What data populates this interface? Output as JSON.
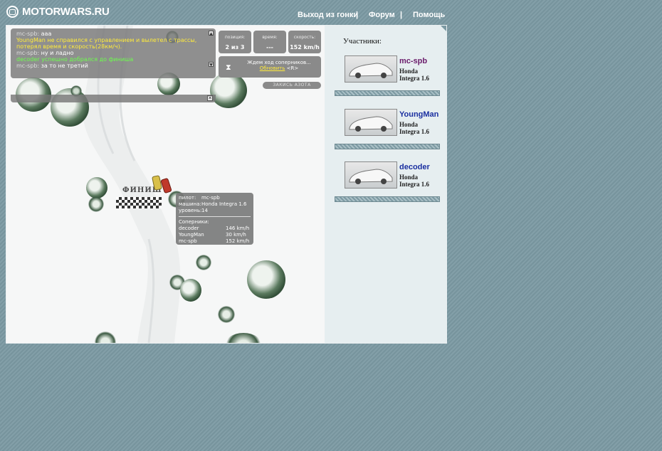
{
  "header": {
    "logo_text": "MOTORWARS.RU",
    "nav": [
      {
        "label": "Выход из гонки"
      },
      {
        "label": "Форум"
      },
      {
        "label": "Помощь"
      }
    ],
    "separator": "|"
  },
  "chat": {
    "lines": [
      {
        "nick": "mc-spb:",
        "text": "ааа",
        "color": "#ffffff"
      },
      {
        "nick": "",
        "text": "YoungMan не справился с управлением и вылетел с трассы,",
        "color": "#ffeb3b"
      },
      {
        "nick": "",
        "text": "потерял время и скорость(28км/ч).",
        "color": "#ffeb3b"
      },
      {
        "nick": "mc-spb:",
        "text": "ну и ладно",
        "color": "#ffffff"
      },
      {
        "nick": "",
        "text": "decoder успешно добрался до финиша",
        "color": "#6cff4c"
      },
      {
        "nick": "mc-spb:",
        "text": "за то не третий",
        "color": "#ffffff"
      }
    ],
    "scroll_up_icon": "▲",
    "scroll_down_icon": "▼",
    "close_icon": "✕"
  },
  "stats": {
    "position_label": "позиция:",
    "position_value": "2 из 3",
    "time_label": "время:",
    "time_value": "---",
    "speed_label": "скорость:",
    "speed_value": "152 km/h"
  },
  "wait": {
    "message": "Ждем ход соперников...",
    "refresh_label": "Обновить",
    "refresh_hotkey": "<R>",
    "hourglass_icon": "⧗"
  },
  "nitro_label": "ЗАКИСЬ АЗОТА",
  "map": {
    "finish_label": "ФИНИШ"
  },
  "tooltip": {
    "pilot_label": "пилот:",
    "pilot_value": "mc-spb",
    "car_label": "машина:",
    "car_value": "Honda Integra 1.6",
    "level_label": "уровень:",
    "level_value": "14",
    "rivals_title": "Соперники:",
    "rivals": [
      {
        "name": "decoder",
        "speed": "146 km/h"
      },
      {
        "name": "YoungMan",
        "speed": "30 km/h"
      },
      {
        "name": "mc-spb",
        "speed": "152 km/h"
      }
    ]
  },
  "participants": {
    "title": "Участники:",
    "list": [
      {
        "name": "mc-spb",
        "car_line1": "Honda",
        "car_line2": "Integra 1.6",
        "color": "#6a1a6a"
      },
      {
        "name": "YoungMan",
        "car_line1": "Honda",
        "car_line2": "Integra 1.6",
        "color": "#1a2fa0"
      },
      {
        "name": "decoder",
        "car_line1": "Honda",
        "car_line2": "Integra 1.6",
        "color": "#1a2fa0"
      }
    ]
  },
  "colors": {
    "background": "#7c9aa3",
    "overlay_gray": "#8a8a8a",
    "highlight_yellow": "#ffeb3b",
    "highlight_green": "#6cff4c"
  }
}
